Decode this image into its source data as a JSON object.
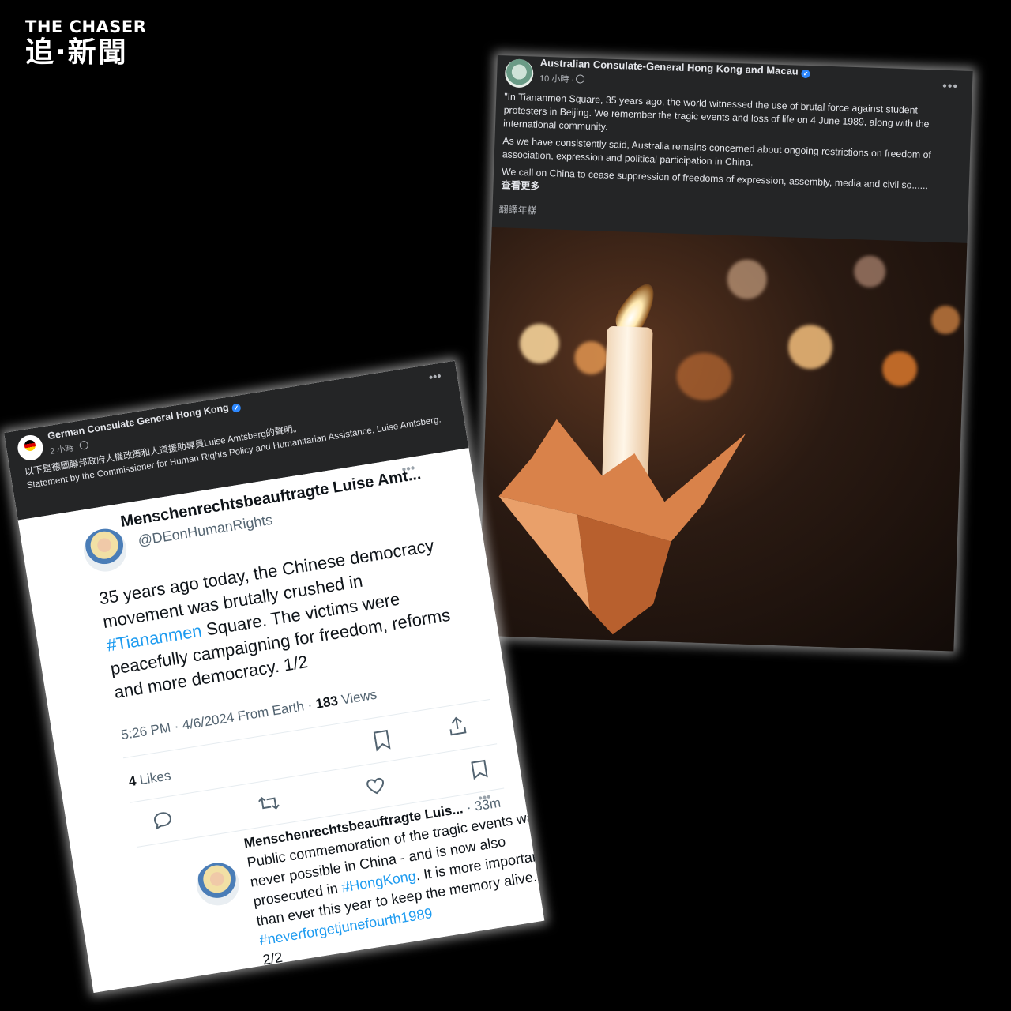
{
  "logo": {
    "line1": "THE CHASER",
    "line2": "追·新聞"
  },
  "australia_post": {
    "page_name": "Australian Consulate-General Hong Kong and Macau",
    "time": "10 小時 ·",
    "paragraph1": "\"In Tiananmen Square, 35 years ago, the world witnessed the use of brutal force against student protesters in Beijing. We remember the tragic events and loss of life on 4 June 1989, along with the international community.",
    "paragraph2": "As we have consistently said, Australia remains concerned about ongoing restrictions on freedom of association, expression and political participation in China.",
    "paragraph3": "We call on China to cease suppression of freedoms of expression, assembly, media and civil so......",
    "see_more": "查看更多",
    "translate": "翻譯年糕",
    "more_icon": "more-horizontal-icon",
    "photo": "candle-vigil-photo"
  },
  "germany_post": {
    "page_name": "German Consulate General Hong Kong",
    "time": "2 小時 ·",
    "text_zh": "以下是德國聯邦政府人權政策和人道援助專員Luise Amtsberg的聲明。",
    "text_en": "Statement by the Commissioner for Human Rights Policy and Humanitarian Assistance, Luise Amtsberg."
  },
  "tweet": {
    "display_name": "Menschenrechtsbeauftragte Luise Amt...",
    "handle": "@DEonHumanRights",
    "body_part1": "35 years ago today, the Chinese democracy movement was brutally crushed in ",
    "hashtag1": "#Tiananmen",
    "body_part2": " Square. The victims were peacefully campaigning for freedom, reforms and more democracy. 1/2",
    "meta_time": "5:26 PM · 4/6/2024 From Earth · ",
    "views_count": "183",
    "views_label": " Views",
    "likes_count": "4",
    "likes_label": " Likes"
  },
  "reply": {
    "display_name": "Menschenrechtsbeauftragte Luis...",
    "time": " · 33m",
    "body_part1": "Public commemoration of the tragic events was never possible in China - and is now also prosecuted in ",
    "hashtag1": "#HongKong",
    "body_part2": ". It is more important than ever this year to keep the memory alive. ",
    "hashtag2": "#neverforgetjunefourth1989",
    "body_part3": "2/2"
  }
}
